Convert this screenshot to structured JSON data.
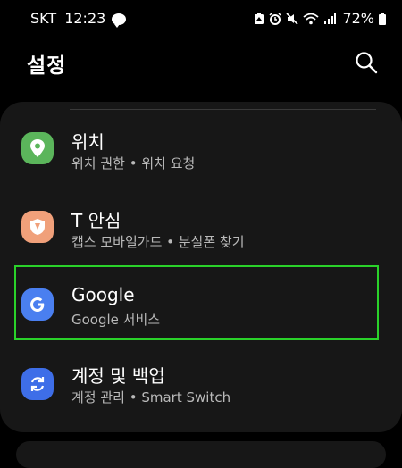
{
  "status_bar": {
    "carrier": "SKT",
    "time": "12:23",
    "battery": "72%",
    "icons": [
      "kakaotalk-icon",
      "battery-saver-icon",
      "alarm-icon",
      "mute-icon",
      "wifi-icon",
      "signal-icon",
      "battery-icon"
    ]
  },
  "header": {
    "title": "설정",
    "search_icon": "search-icon"
  },
  "settings": [
    {
      "id": "location",
      "title": "위치",
      "subtitle": "위치 권한  •  위치 요청",
      "icon": "location-pin-icon",
      "icon_color": "#5bb55b"
    },
    {
      "id": "t-safety",
      "title": "T 안심",
      "subtitle": "캡스 모바일가드  •  분실폰 찾기",
      "icon": "shield-icon",
      "icon_color": "#f0a07a"
    },
    {
      "id": "google",
      "title": "Google",
      "subtitle": "Google 서비스",
      "icon": "google-g-icon",
      "icon_color": "#4a7ff0"
    },
    {
      "id": "accounts",
      "title": "계정 및 백업",
      "subtitle": "계정 관리  •  Smart Switch",
      "icon": "sync-icon",
      "icon_color": "#3e6ee8"
    }
  ],
  "colors": {
    "background": "#000000",
    "card": "#171717",
    "subtitle_text": "#b9b9b9",
    "highlight_box": "#2ad12a"
  }
}
